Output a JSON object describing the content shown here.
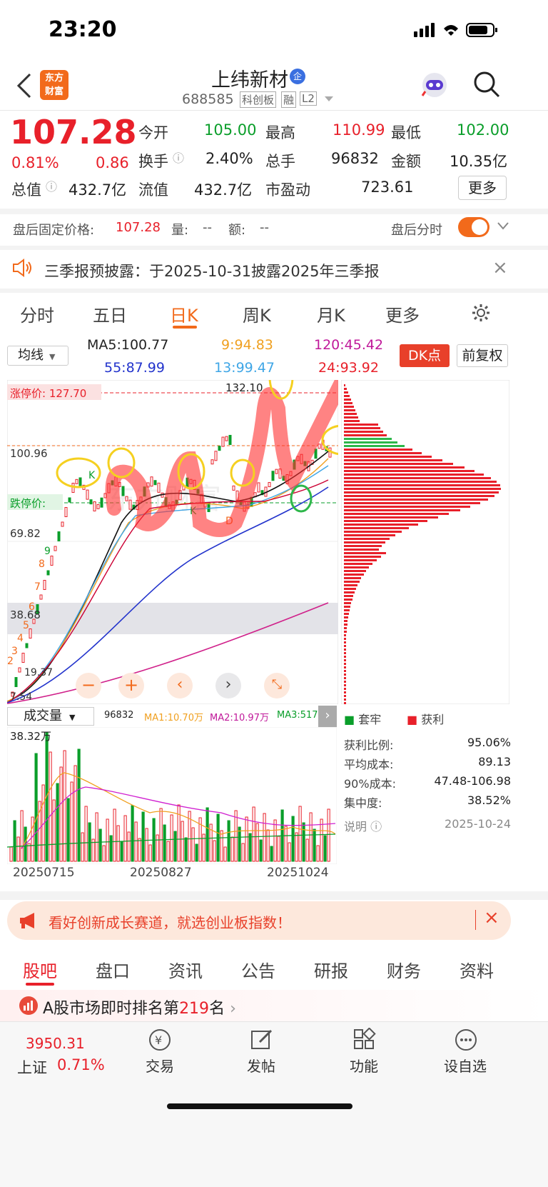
{
  "status_bar": {
    "time": "23:20"
  },
  "header": {
    "title": "上纬新材",
    "title_badge": "企",
    "code": "688585",
    "tags": [
      "科创板",
      "融",
      "L2"
    ],
    "logo_line1": "东方",
    "logo_line2": "财富"
  },
  "quote": {
    "price": "107.28",
    "change_pct": "0.81%",
    "change": "0.86",
    "fields": [
      {
        "label": "今开",
        "value": "105.00",
        "color": "green"
      },
      {
        "label": "最高",
        "value": "110.99",
        "color": "red"
      },
      {
        "label": "最低",
        "value": "102.00",
        "color": "green"
      },
      {
        "label": "换手",
        "value": "2.40%",
        "color": "black"
      },
      {
        "label": "总手",
        "value": "96832",
        "color": "black"
      },
      {
        "label": "金额",
        "value": "10.35亿",
        "color": "black"
      },
      {
        "label": "总值",
        "value": "432.7亿",
        "color": "black"
      },
      {
        "label": "流值",
        "value": "432.7亿",
        "color": "black"
      },
      {
        "label": "市盈动",
        "value": "723.61",
        "color": "black"
      }
    ],
    "more_button": "更多"
  },
  "after_hours": {
    "label": "盘后固定价格:",
    "price": "107.28",
    "vol_label": "量:",
    "vol": "--",
    "amt_label": "额:",
    "amt": "--",
    "toggle_label": "盘后分时",
    "toggle_on": true
  },
  "notice": {
    "text": "三季报预披露：于2025-10-31披露2025年三季报"
  },
  "chart_tabs": [
    "分时",
    "五日",
    "日K",
    "周K",
    "月K",
    "更多"
  ],
  "active_tab": "日K",
  "ma_panel": {
    "dropdown": "均线",
    "ma5": "MA5:100.77",
    "ma9": "9:94.83",
    "ma120": "120:45.42",
    "ma55": "55:87.99",
    "ma13": "13:99.47",
    "ma24": "24:93.92",
    "dk_button": "DK点",
    "fq_button": "前复权"
  },
  "kline": {
    "high_label": "132.10",
    "limit_up_label": "涨停价: 127.70",
    "limit_down_label": "跌停价:",
    "y_labels": [
      "100.96",
      "69.82",
      "38.68",
      "19.37",
      "7.54"
    ],
    "markers": [
      "K",
      "K",
      "D",
      "9",
      "8",
      "7",
      "6",
      "5",
      "4",
      "3",
      "2"
    ]
  },
  "volume": {
    "dropdown": "成交量",
    "vol": "96832",
    "ma1": "MA1:10.70万",
    "ma2": "MA2:10.97万",
    "ma3": "MA3:51746",
    "max_label": "38.32万",
    "dates": [
      "20250715",
      "20250827",
      "20251024"
    ]
  },
  "chip": {
    "legend_trapped": "套牢",
    "legend_profit": "获利",
    "rows": [
      {
        "label": "获利比例:",
        "value": "95.06%"
      },
      {
        "label": "平均成本:",
        "value": "89.13"
      },
      {
        "label": "90%成本:",
        "value": "47.48-106.98"
      },
      {
        "label": "集中度:",
        "value": "38.52%"
      }
    ],
    "note_label": "说明",
    "date": "2025-10-24"
  },
  "ad": {
    "text": "看好创新成长赛道，就选创业板指数！"
  },
  "bottom_tabs": [
    "股吧",
    "盘口",
    "资讯",
    "公告",
    "研报",
    "财务",
    "资料"
  ],
  "active_bottom_tab": "股吧",
  "rank": {
    "prefix": "A股市场即时排名第",
    "number": "219",
    "suffix": "名"
  },
  "footer": {
    "index_value": "3950.31",
    "index_name": "上证",
    "index_change": "0.71%",
    "items": [
      "交易",
      "发帖",
      "功能",
      "设自选"
    ]
  },
  "colors": {
    "up": "#e8202a",
    "down": "#0a9e2a",
    "accent": "#f26a1b"
  }
}
